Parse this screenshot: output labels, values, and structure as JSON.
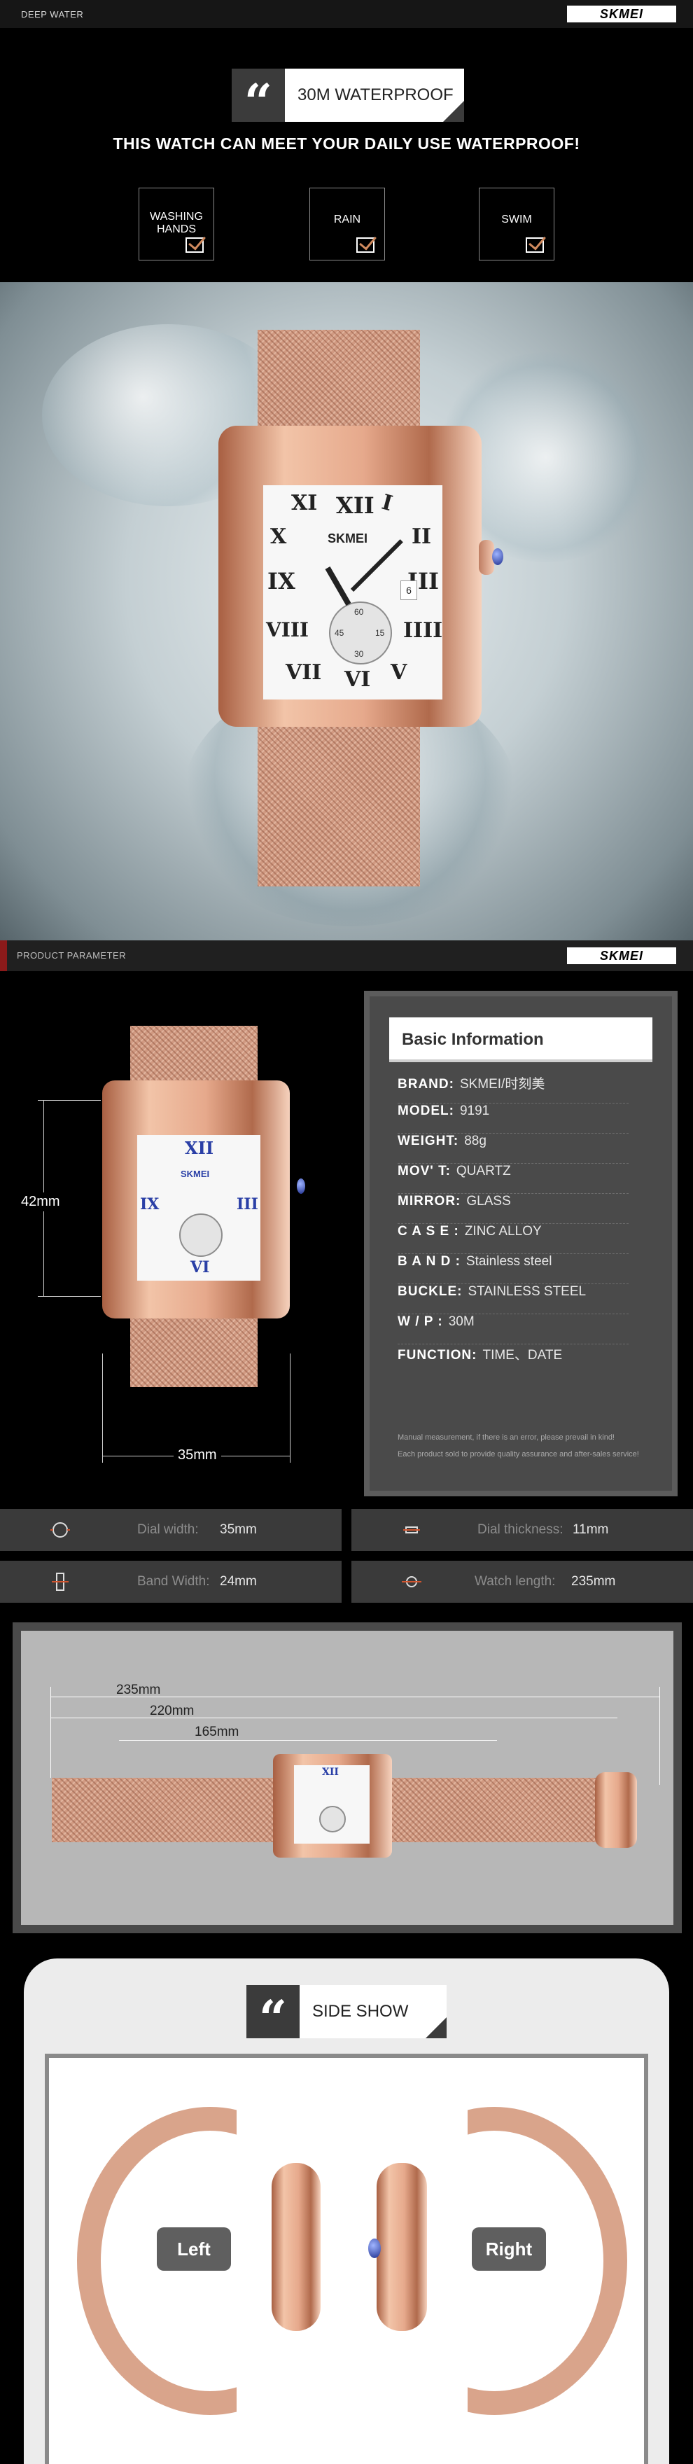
{
  "top_bar": {
    "left_text": "DEEP WATER",
    "logo": "SKMEI"
  },
  "waterproof": {
    "title": "30M WATERPROOF",
    "subtitle": "THIS WATCH CAN MEET YOUR DAILY USE WATERPROOF!",
    "cards": [
      {
        "label": "WASHING HANDS"
      },
      {
        "label": "RAIN"
      },
      {
        "label": "SWIM"
      }
    ]
  },
  "hero_watch": {
    "brand": "SKMEI",
    "numerals": [
      "XII",
      "I",
      "II",
      "III",
      "IIII",
      "V",
      "VI",
      "VII",
      "VIII",
      "IX",
      "X",
      "XI"
    ],
    "subdial_numbers": [
      "60",
      "15",
      "30",
      "45"
    ],
    "date": "6"
  },
  "param_bar": {
    "left_text": "PRODUCT PARAMETER",
    "logo": "SKMEI"
  },
  "dimensions": {
    "height": "42mm",
    "width": "35mm"
  },
  "basic_info": {
    "title": "Basic Information",
    "rows": [
      {
        "key": "BRAND:",
        "value": "SKMEI/时刻美"
      },
      {
        "key": "MODEL:",
        "value": "9191"
      },
      {
        "key": "WEIGHT:",
        "value": "88g"
      },
      {
        "key": "MOV' T:",
        "value": "QUARTZ"
      },
      {
        "key": "MIRROR:",
        "value": "GLASS"
      },
      {
        "key": "C A S E :",
        "value": "ZINC ALLOY"
      },
      {
        "key": "B A N D :",
        "value": "Stainless steel"
      },
      {
        "key": "BUCKLE:",
        "value": "STAINLESS STEEL"
      },
      {
        "key": "W / P :",
        "value": "30M"
      },
      {
        "key": "FUNCTION:",
        "value": "TIME、DATE"
      }
    ],
    "note_line1": "Manual measurement, if there is an error, please prevail in kind!",
    "note_line2": "Each product sold to provide quality assurance and after-sales service!"
  },
  "dim_boxes": [
    {
      "label": "Dial width:",
      "value": "35mm",
      "icon": "watch-dial-icon"
    },
    {
      "label": "Dial thickness:",
      "value": "11mm",
      "icon": "thickness-icon"
    },
    {
      "label": "Band Width:",
      "value": "24mm",
      "icon": "band-width-icon"
    },
    {
      "label": "Watch length:",
      "value": "235mm",
      "icon": "watch-length-icon"
    }
  ],
  "lengths": {
    "l1": "235mm",
    "l2": "220mm",
    "l3": "165mm"
  },
  "side_show": {
    "title": "SIDE SHOW",
    "left_label": "Left",
    "right_label": "Right"
  },
  "colors": {
    "rose_gold": "#d19a82",
    "dark_panel": "#3a3a3a",
    "accent": "#8b1a1a",
    "hand_blue": "#2a3fa6"
  }
}
